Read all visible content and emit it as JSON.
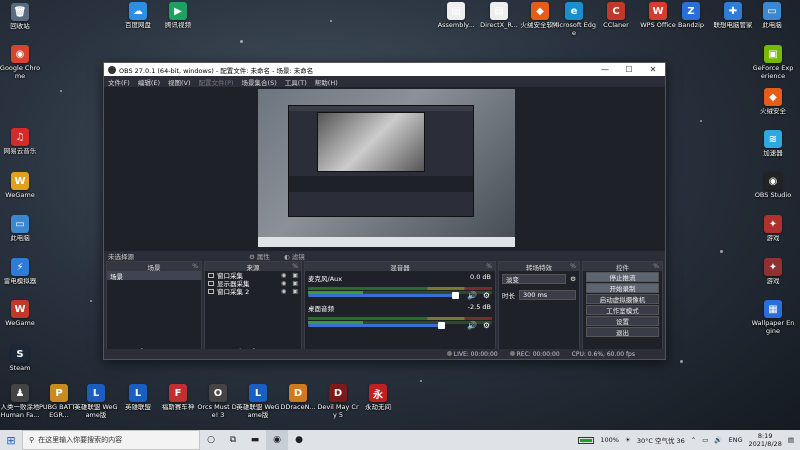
{
  "desktop": {
    "left_icons": [
      {
        "label": "回收站",
        "color": "#5a6b7e",
        "glyph": "🗑"
      },
      {
        "label": "Google Chrome",
        "color": "#d9442f",
        "glyph": "◉"
      },
      {
        "label": "网易云音乐",
        "color": "#d42a2a",
        "glyph": "♫"
      },
      {
        "label": "WeGame",
        "color": "#e0a020",
        "glyph": "W"
      },
      {
        "label": "此电脑",
        "color": "#3b87d0",
        "glyph": "▭"
      },
      {
        "label": "雷电模拟器",
        "color": "#2f7bd8",
        "glyph": "⚡"
      },
      {
        "label": "WeGame",
        "color": "#c0392b",
        "glyph": "W"
      },
      {
        "label": "Steam",
        "color": "#1b2838",
        "glyph": "S"
      }
    ],
    "top_icons": [
      {
        "label": "百度网盘",
        "color": "#2f8de4",
        "glyph": "☁"
      },
      {
        "label": "腾讯视频",
        "color": "#20a060",
        "glyph": "▶"
      },
      {
        "label": "Assembly...",
        "color": "#eeeeee",
        "glyph": "▤"
      },
      {
        "label": "DirectX_R...",
        "color": "#eeeeee",
        "glyph": "▤"
      },
      {
        "label": "火绒安全软件",
        "color": "#e85c1a",
        "glyph": "◆"
      },
      {
        "label": "Microsoft Edge",
        "color": "#1a8fd0",
        "glyph": "e"
      },
      {
        "label": "CClaner",
        "color": "#c0392b",
        "glyph": "C"
      },
      {
        "label": "WPS Office",
        "color": "#d63b2f",
        "glyph": "W"
      },
      {
        "label": "Bandzip",
        "color": "#2a6fd8",
        "glyph": "Z"
      },
      {
        "label": "联想电脑管家",
        "color": "#2f7bd8",
        "glyph": "✚"
      },
      {
        "label": "此电脑",
        "color": "#3b87d0",
        "glyph": "▭"
      }
    ],
    "right_icons": [
      {
        "label": "GeForce Experience",
        "color": "#76b900",
        "glyph": "▣"
      },
      {
        "label": "火绒安全",
        "color": "#e85c1a",
        "glyph": "◆"
      },
      {
        "label": "加速器",
        "color": "#2fa8e0",
        "glyph": "≋"
      },
      {
        "label": "OBS Studio",
        "color": "#222222",
        "glyph": "◉"
      },
      {
        "label": "游戏",
        "color": "#b03030",
        "glyph": "✦"
      },
      {
        "label": "游戏",
        "color": "#903030",
        "glyph": "✦"
      },
      {
        "label": "Wallpaper Engine",
        "color": "#2a6fd8",
        "glyph": "▦"
      }
    ],
    "bottom_icons": [
      {
        "label": "人类一败涂地 Human Fa...",
        "color": "#444444",
        "glyph": "♟"
      },
      {
        "label": "PUBG BATTLEGR...",
        "color": "#c98a22",
        "glyph": "P"
      },
      {
        "label": "英雄联盟 WeGame版",
        "color": "#1a5ec0",
        "glyph": "L"
      },
      {
        "label": "英雄联盟",
        "color": "#1a5ec0",
        "glyph": "L"
      },
      {
        "label": "福斯赛车神",
        "color": "#c03030",
        "glyph": "F"
      },
      {
        "label": "Orcs Must Die! 3",
        "color": "#444444",
        "glyph": "O"
      },
      {
        "label": "英雄联盟 WeGame版",
        "color": "#1a5ec0",
        "glyph": "L"
      },
      {
        "label": "DDraceN...",
        "color": "#d07a20",
        "glyph": "D"
      },
      {
        "label": "Devil May Cry 5",
        "color": "#7a1a1a",
        "glyph": "D"
      },
      {
        "label": "永劫无间",
        "color": "#c02020",
        "glyph": "永"
      }
    ]
  },
  "obs": {
    "title": "OBS 27.0.1 (64-bit, windows) - 配置文件: 未命名 - 场景: 未命名",
    "menu": [
      "文件(F)",
      "编辑(E)",
      "视图(V)",
      "配置文件(P)",
      "场景集合(S)",
      "工具(T)",
      "帮助(H)"
    ],
    "source_bar": {
      "label": "未选择源",
      "properties": "属性",
      "filters": "滤镜"
    },
    "scenes": {
      "header": "场景",
      "items": [
        "场景"
      ]
    },
    "sources": {
      "header": "来源",
      "items": [
        "窗口采集",
        "显示器采集",
        "窗口采集 2"
      ]
    },
    "mixer": {
      "header": "混音器",
      "channels": [
        {
          "name": "麦克风/Aux",
          "db": "0.0 dB"
        },
        {
          "name": "桌面音频",
          "db": "-2.5 dB"
        }
      ]
    },
    "transitions": {
      "header": "转场特效",
      "selected": "淡变",
      "duration_label": "时长",
      "duration": "300 ms"
    },
    "controls": {
      "header": "控件",
      "buttons": [
        "停止推流",
        "开始录制",
        "启动虚拟摄像机",
        "工作室模式",
        "设置",
        "退出"
      ]
    },
    "status": {
      "live": "LIVE: 00:00:00",
      "rec": "REC: 00:00:00",
      "cpu": "CPU: 0.6%, 60.00 fps"
    }
  },
  "taskbar": {
    "search_placeholder": "在这里输入你要搜索的内容",
    "battery": "100%",
    "weather": "30°C 空气优 36",
    "lang": "ENG",
    "time": "8:19",
    "date": "2021/8/28"
  }
}
